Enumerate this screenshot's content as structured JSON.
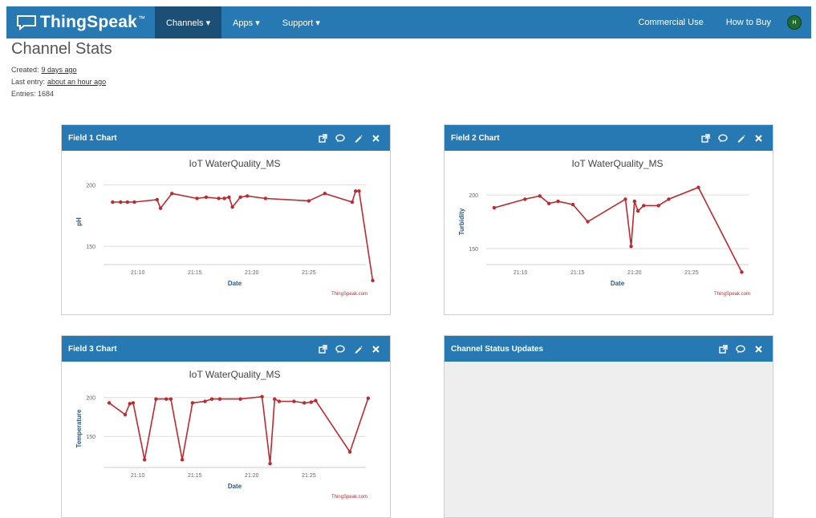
{
  "brand": {
    "name": "ThingSpeak",
    "tm": "™"
  },
  "nav": {
    "channels": "Channels ▾",
    "apps": "Apps ▾",
    "support": "Support ▾",
    "commercial": "Commercial Use",
    "how_to_buy": "How to Buy",
    "avatar": "H"
  },
  "page_title": "Channel Stats",
  "stats": {
    "created_label": "Created:",
    "created_value": "9 days ago",
    "last_entry_label": "Last entry:",
    "last_entry_value": "about an hour ago",
    "entries_label": "Entries:",
    "entries_value": "1684"
  },
  "panels": {
    "field1": "Field 1 Chart",
    "field2": "Field 2 Chart",
    "field3": "Field 3 Chart",
    "status": "Channel Status Updates"
  },
  "colors": {
    "nav": "#2779b4",
    "nav_active": "#1c4f75",
    "series": "#c0282d"
  },
  "chart_data": [
    {
      "type": "line",
      "title": "IoT WaterQuality_MS",
      "xlabel": "Date",
      "ylabel": "pH",
      "credit": "ThingSpeak.com",
      "ylim": [
        135,
        205
      ],
      "yticks": [
        150,
        200
      ],
      "xlim": [
        7.0,
        30.0
      ],
      "xticks": [
        10,
        15,
        20,
        25
      ],
      "xtick_labels": [
        "21:10",
        "21:15",
        "21:20",
        "21:25"
      ],
      "series": [
        {
          "x": [
            7.8,
            8.5,
            9.1,
            9.7,
            11.7,
            12.0,
            13.0,
            15.2,
            16.0,
            17.1,
            17.6,
            18.0,
            18.3,
            19.0,
            19.6,
            21.2,
            25.0,
            26.4,
            28.8,
            29.1,
            29.4,
            30.6
          ],
          "values": [
            186,
            186,
            186,
            186,
            188,
            181,
            193,
            189,
            190,
            189,
            189,
            190,
            182,
            190,
            191,
            189,
            187,
            193,
            186,
            195,
            195,
            122
          ]
        }
      ]
    },
    {
      "type": "line",
      "title": "IoT WaterQuality_MS",
      "xlabel": "Date",
      "ylabel": "Turbidity",
      "credit": "ThingSpeak.com",
      "ylim": [
        135,
        215
      ],
      "yticks": [
        150,
        200
      ],
      "xlim": [
        7.0,
        30.0
      ],
      "xticks": [
        10,
        15,
        20,
        25
      ],
      "xtick_labels": [
        "21:10",
        "21:15",
        "21:20",
        "21:25"
      ],
      "series": [
        {
          "x": [
            7.7,
            10.4,
            11.7,
            12.5,
            13.3,
            14.6,
            15.9,
            19.2,
            19.7,
            20.0,
            20.3,
            20.8,
            22.1,
            23.0,
            25.6,
            29.4
          ],
          "values": [
            188,
            196,
            199,
            192,
            194,
            191,
            175,
            196,
            152,
            194,
            185,
            190,
            190,
            196,
            207,
            128
          ]
        }
      ]
    },
    {
      "type": "line",
      "title": "IoT WaterQuality_MS",
      "xlabel": "Date",
      "ylabel": "Temperature",
      "credit": "ThingSpeak.com",
      "ylim": [
        110,
        210
      ],
      "yticks": [
        150,
        200
      ],
      "xlim": [
        7.0,
        30.0
      ],
      "xticks": [
        10,
        15,
        20,
        25
      ],
      "xtick_labels": [
        "21:10",
        "21:15",
        "21:20",
        "21:25"
      ],
      "series": [
        {
          "x": [
            7.5,
            8.9,
            9.3,
            9.6,
            10.6,
            11.6,
            12.5,
            12.9,
            13.9,
            14.8,
            15.9,
            16.5,
            17.2,
            19.0,
            20.9,
            21.6,
            22.0,
            22.4,
            23.7,
            24.6,
            25.2,
            25.6,
            28.6,
            30.2
          ],
          "values": [
            193,
            178,
            192,
            193,
            120,
            198,
            198,
            198,
            120,
            193,
            195,
            198,
            198,
            198,
            201,
            115,
            198,
            195,
            195,
            193,
            194,
            196,
            130,
            199
          ]
        }
      ]
    }
  ]
}
